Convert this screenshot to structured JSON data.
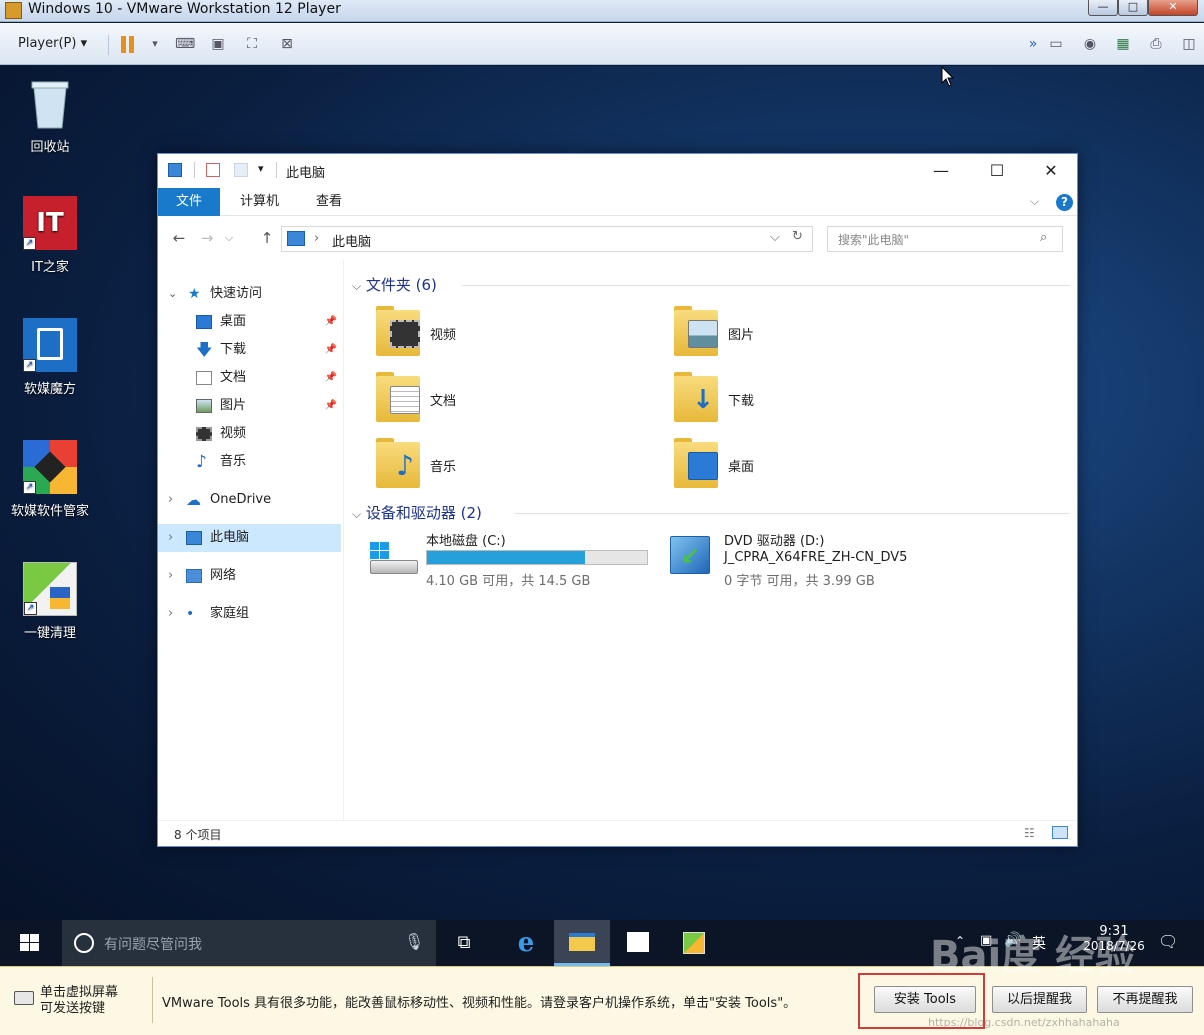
{
  "vm": {
    "title": "Windows 10 - VMware Workstation 12 Player",
    "player_menu": "Player(P)",
    "window_min": "—",
    "window_max": "□",
    "window_close": "✕"
  },
  "desktop": {
    "icons": [
      {
        "label": "回收站",
        "icon": "recycle-bin-icon"
      },
      {
        "label": "IT之家",
        "icon": "ithome-icon",
        "badge": "IT"
      },
      {
        "label": "软媒魔方",
        "icon": "ruanmei-cube-icon"
      },
      {
        "label": "软媒软件管家",
        "icon": "software-manager-icon"
      },
      {
        "label": "一键清理",
        "icon": "cleanup-icon"
      }
    ]
  },
  "explorer": {
    "title": "此电脑",
    "ribbon_tabs": [
      "文件",
      "计算机",
      "查看"
    ],
    "address_path": "此电脑",
    "search_placeholder": "搜索\"此电脑\"",
    "nav": {
      "quick_access": "快速访问",
      "quick_items": [
        "桌面",
        "下载",
        "文档",
        "图片",
        "视频",
        "音乐"
      ],
      "onedrive": "OneDrive",
      "this_pc": "此电脑",
      "network": "网络",
      "homegroup": "家庭组"
    },
    "folders_header": "文件夹 (6)",
    "folders": [
      "视频",
      "图片",
      "文档",
      "下载",
      "音乐",
      "桌面"
    ],
    "drives_header": "设备和驱动器 (2)",
    "drives": [
      {
        "name": "本地磁盘 (C:)",
        "space": "4.10 GB 可用，共 14.5 GB",
        "used_fraction": 0.72
      },
      {
        "name": "DVD 驱动器 (D:)",
        "label": "J_CPRA_X64FRE_ZH-CN_DV5",
        "space": "0 字节 可用，共 3.99 GB"
      }
    ],
    "status": "8 个项目"
  },
  "taskbar": {
    "search_placeholder": "有问题尽管问我",
    "time": "9:31",
    "date": "2018/7/26",
    "ime": "英"
  },
  "notify": {
    "hint_line1": "单击虚拟屏幕",
    "hint_line2": "可发送按键",
    "message": "VMware Tools 具有很多功能，能改善鼠标移动性、视频和性能。请登录客户机操作系统，单击\"安装 Tools\"。",
    "install_button": "安装 Tools",
    "remind_later_button": "以后提醒我",
    "never_remind_button": "不再提醒我"
  },
  "watermark": {
    "brand": "Bai度 经验",
    "url": "https://blog.csdn.net/zxhhahahaha"
  },
  "colors": {
    "accent": "#1979ca",
    "selection": "#cce8ff",
    "drive_bar": "#26a0da",
    "highlight_box": "#d23b3b"
  }
}
